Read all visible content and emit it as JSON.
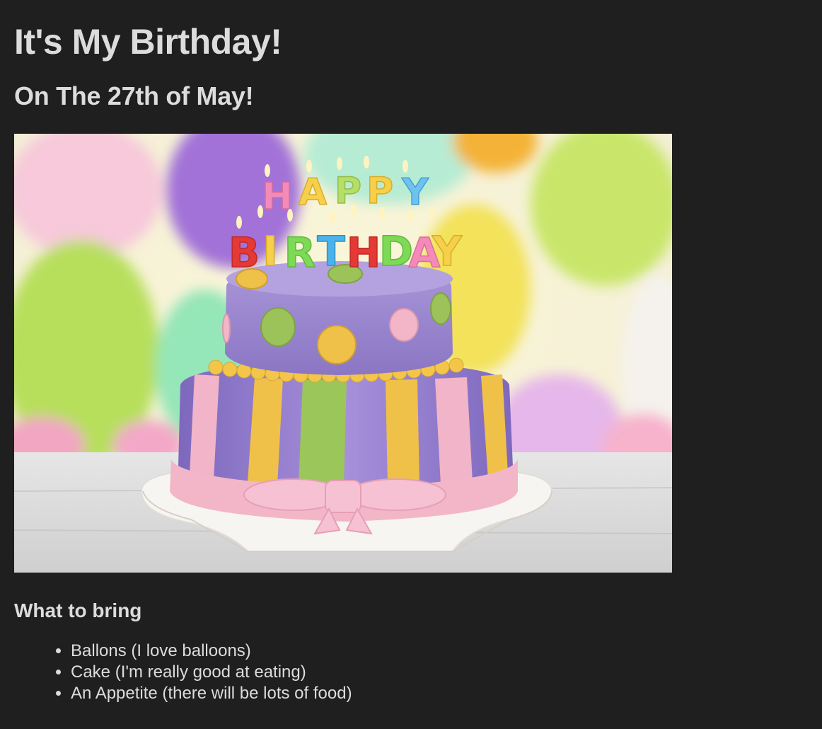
{
  "page": {
    "title": "It's My Birthday!",
    "subtitle": "On The 27th of May!",
    "section_heading": "What to bring",
    "items": [
      "Ballons (I love balloons)",
      "Cake (I'm really good at eating)",
      "An Appetite (there will be lots of food)"
    ]
  },
  "image": {
    "candle_text_top": "HAPPY",
    "candle_text_bottom": "BIRTHDAY"
  },
  "colors": {
    "background": "#1f1f1f",
    "text": "#dcdcdc",
    "cake_purple": "#9a86d0",
    "cake_pink": "#f2b6c8",
    "cake_yellow": "#f0c44a",
    "cake_green": "#9cc35a"
  }
}
